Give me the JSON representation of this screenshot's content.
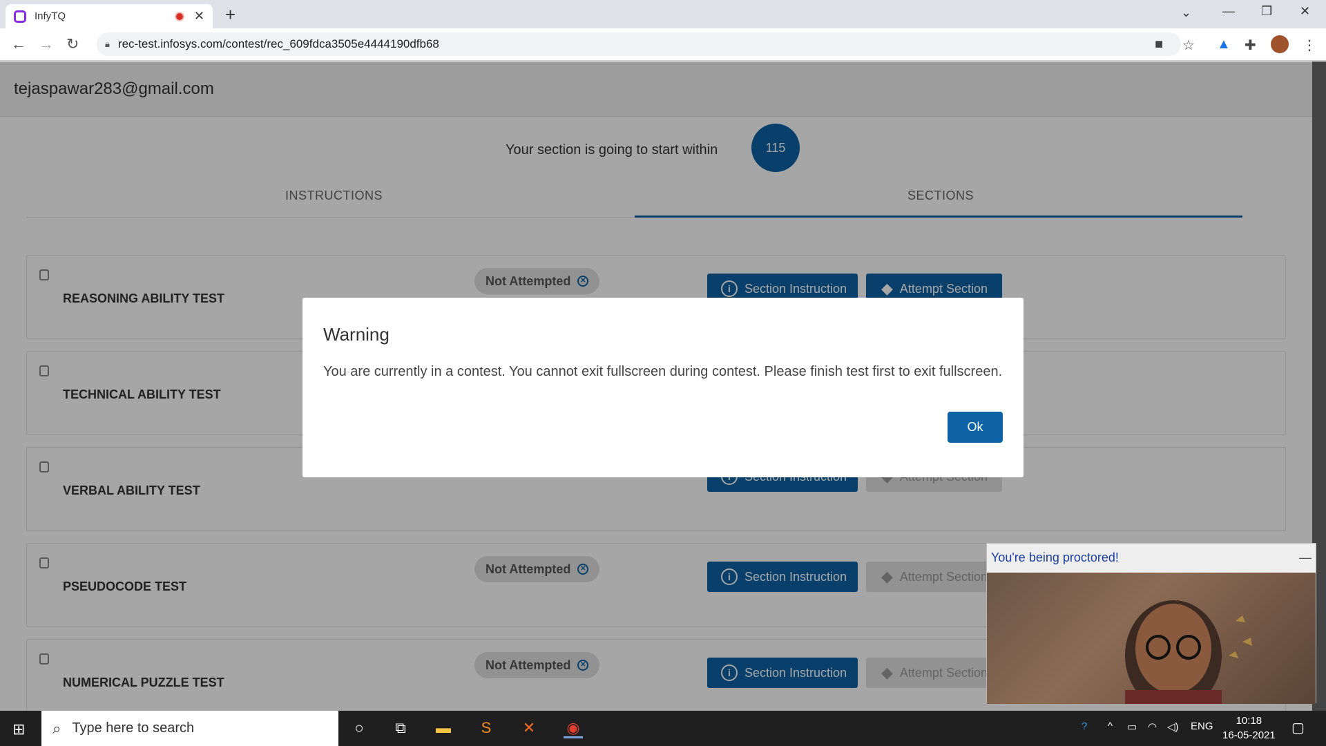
{
  "browser": {
    "tab_title": "InfyTQ",
    "url": "rec-test.infosys.com/contest/rec_609fdca3505e4444190dfb68"
  },
  "page": {
    "user_email": "tejaspawar283@gmail.com",
    "start_text": "Your section is going to start within",
    "timer_value": "115",
    "tabs": [
      "INSTRUCTIONS",
      "SECTIONS"
    ],
    "sections": [
      {
        "name": "REASONING ABILITY TEST",
        "status": "Not Attempted",
        "instr_label": "Section Instruction",
        "attempt_label": "Attempt Section"
      },
      {
        "name": "TECHNICAL ABILITY TEST",
        "status": "",
        "instr_label": "",
        "attempt_label": ""
      },
      {
        "name": "VERBAL ABILITY TEST",
        "status": "",
        "instr_label": "Section Instruction",
        "attempt_label": "Attempt Section"
      },
      {
        "name": "PSEUDOCODE TEST",
        "status": "Not Attempted",
        "instr_label": "Section Instruction",
        "attempt_label": "Attempt Section"
      },
      {
        "name": "NUMERICAL PUZZLE TEST",
        "status": "Not Attempted",
        "instr_label": "Section Instruction",
        "attempt_label": "Attempt Section"
      }
    ]
  },
  "modal": {
    "title": "Warning",
    "message": "You are currently in a contest. You cannot exit fullscreen during contest. Please finish test first to exit fullscreen.",
    "ok_label": "Ok"
  },
  "proctor": {
    "label": "You're being proctored!"
  },
  "taskbar": {
    "search_placeholder": "Type here to search",
    "lang": "ENG",
    "time": "10:18",
    "date": "16-05-2021"
  },
  "colors": {
    "primary": "#0d63a5",
    "disabled": "#e0e0e0"
  }
}
